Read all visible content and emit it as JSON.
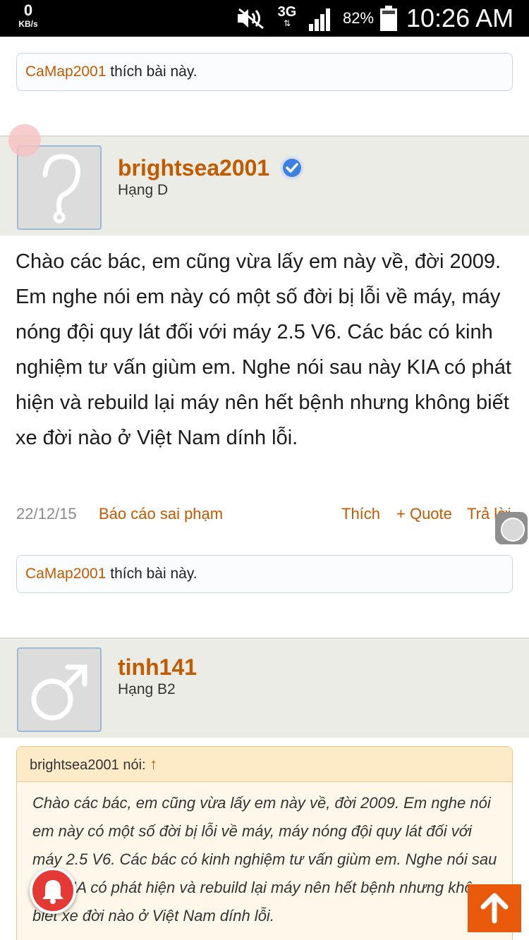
{
  "status_bar": {
    "speed_value": "0",
    "speed_unit": "KB/s",
    "network_type": "3G",
    "battery_percent": "82%",
    "time": "10:26 AM"
  },
  "posts": [
    {
      "likes": {
        "user": "CaMap2001",
        "text": " thích bài này."
      }
    },
    {
      "username": "brightsea2001",
      "rank": "Hạng D",
      "verified": true,
      "body": "Chào các bác, em cũng vừa lấy em này về, đời 2009. Em nghe nói em này có một số đời bị lỗi về máy, máy nóng đội quy lát đối với máy 2.5 V6. Các bác có kinh nghiệm tư vấn giùm em. Nghe nói sau này KIA có phát hiện và rebuild lại máy nên hết bệnh nhưng không biết xe đời nào ở Việt Nam dính lỗi.",
      "date": "22/12/15",
      "report_label": "Báo cáo sai phạm",
      "like_label": "Thích",
      "quote_label": "+ Quote",
      "reply_label": "Trả lời",
      "likes": {
        "user": "CaMap2001",
        "text": " thích bài này."
      }
    },
    {
      "username": "tinh141",
      "rank": "Hạng B2",
      "quote": {
        "author_line": "brightsea2001 nói: ",
        "arrow": "↑",
        "text": "Chào các bác, em cũng vừa lấy em này về, đời 2009. Em nghe nói em này có một số đời bị lỗi về máy, máy nóng đội quy lát đối với máy 2.5 V6. Các bác có kinh nghiệm tư vấn giùm em. Nghe nói sau này KIA có phát hiện và rebuild lại máy nên hết bệnh nhưng không biết xe đời nào ở Việt Nam dính lỗi."
      }
    }
  ],
  "colors": {
    "accent": "#c25a00",
    "header_bg": "#ecece7",
    "scroll_top_button": "#e8590c",
    "notification_button": "#e53935"
  },
  "icons": [
    "wifi-muted-icon",
    "signal-icon",
    "battery-icon",
    "verified-icon",
    "avatar-question-icon",
    "avatar-male-icon",
    "bell-icon",
    "arrow-up-icon"
  ]
}
